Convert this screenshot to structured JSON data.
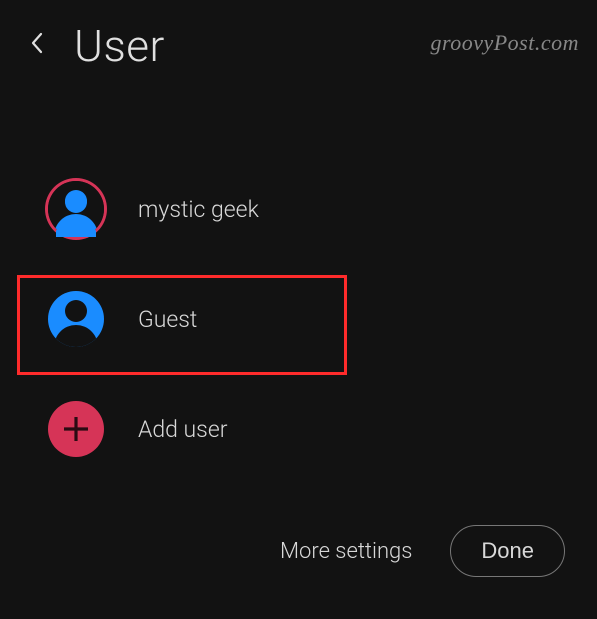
{
  "header": {
    "title": "User"
  },
  "watermark": "groovyPost.com",
  "users": [
    {
      "label": "mystic geek",
      "selected": true
    },
    {
      "label": "Guest",
      "selected": false
    }
  ],
  "add_user_label": "Add user",
  "footer": {
    "more_settings": "More settings",
    "done": "Done"
  }
}
